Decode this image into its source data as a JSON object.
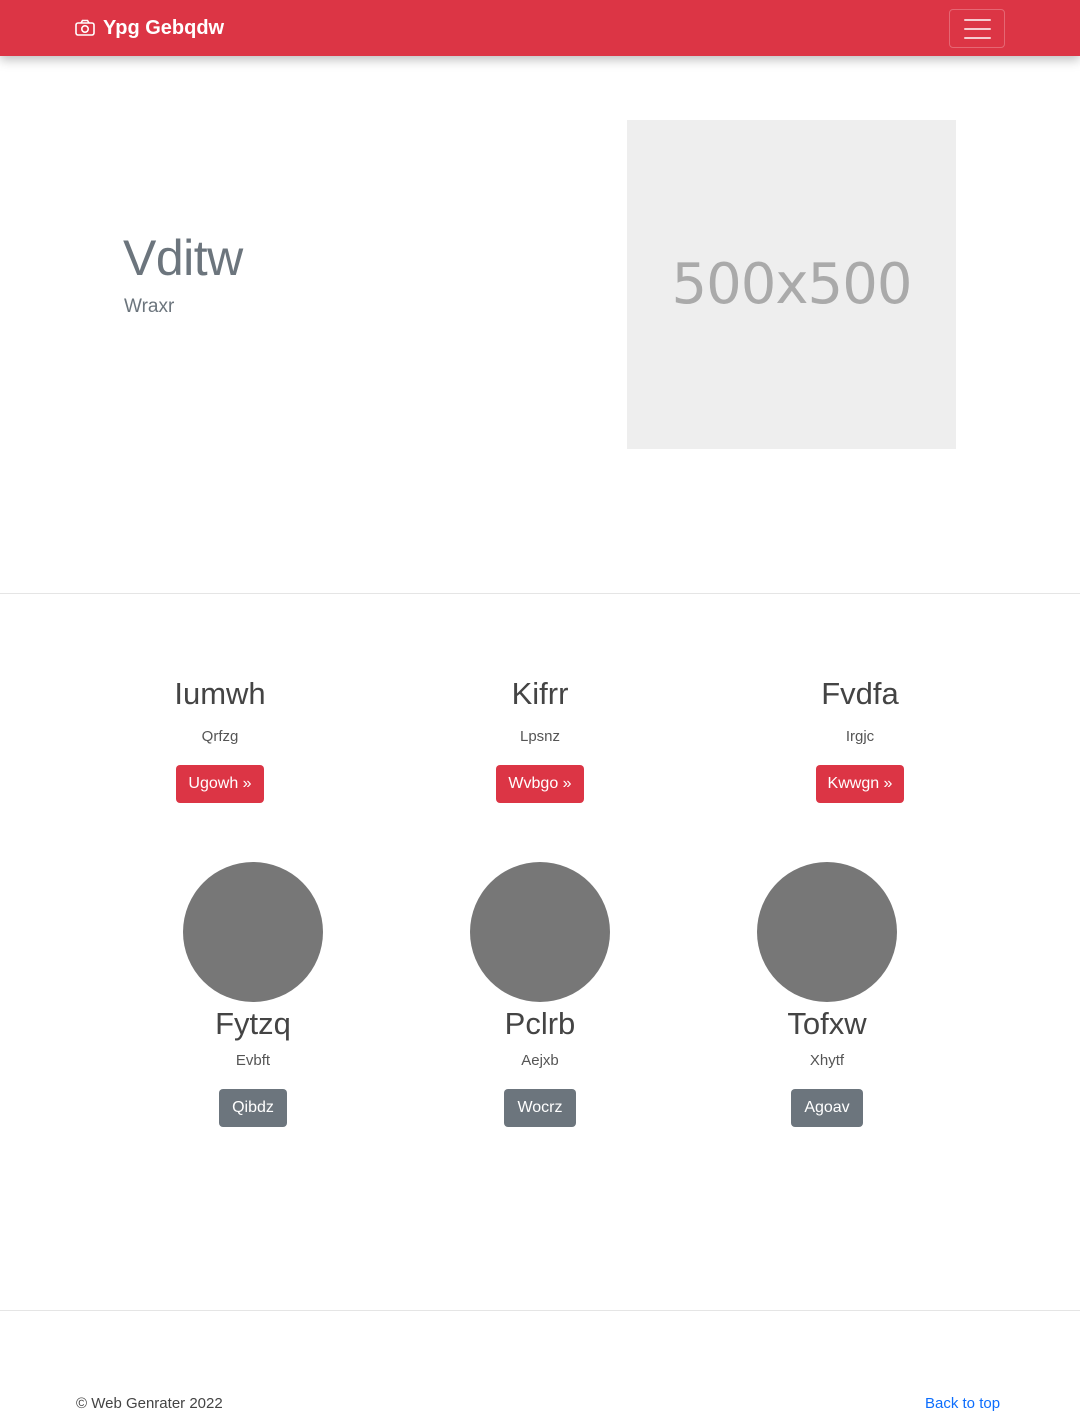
{
  "navbar": {
    "brand": "Ypg Gebqdw",
    "brand_icon": "camera-icon",
    "toggler_icon": "hamburger-icon",
    "color": "#dc3545"
  },
  "hero": {
    "title": "Vditw",
    "subtitle": "Wraxr",
    "placeholder_text": "500x500"
  },
  "features": [
    {
      "title": "Iumwh",
      "text": "Qrfzg",
      "button": "Ugowh »"
    },
    {
      "title": "Kifrr",
      "text": "Lpsnz",
      "button": "Wvbgo »"
    },
    {
      "title": "Fvdfa",
      "text": "Irgjc",
      "button": "Kwwgn »"
    }
  ],
  "people": [
    {
      "name": "Fytzq",
      "text": "Evbft",
      "button": "Qibdz"
    },
    {
      "name": "Pclrb",
      "text": "Aejxb",
      "button": "Wocrz"
    },
    {
      "name": "Tofxw",
      "text": "Xhytf",
      "button": "Agoav"
    }
  ],
  "footer": {
    "copyright": "© Web Genrater 2022",
    "back_to_top": "Back to top"
  }
}
